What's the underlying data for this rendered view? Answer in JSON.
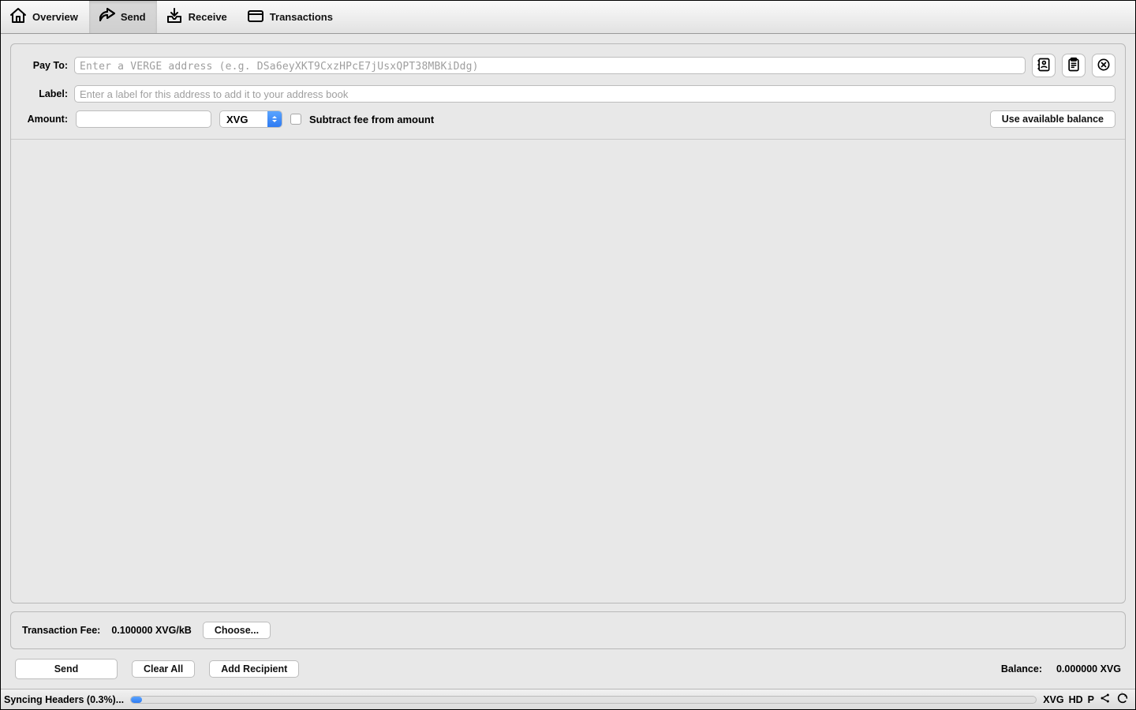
{
  "toolbar": {
    "overview": "Overview",
    "send": "Send",
    "receive": "Receive",
    "transactions": "Transactions"
  },
  "form": {
    "pay_to_label": "Pay To:",
    "pay_to_placeholder": "Enter a VERGE address (e.g. DSa6eyXKT9CxzHPcE7jUsxQPT38MBKiDdg)",
    "label_label": "Label:",
    "label_placeholder": "Enter a label for this address to add it to your address book",
    "amount_label": "Amount:",
    "unit_selected": "XVG",
    "subtract_fee_label": "Subtract fee from amount",
    "use_balance_btn": "Use available balance"
  },
  "fee": {
    "label": "Transaction Fee:",
    "value": "0.100000 XVG/kB",
    "choose_btn": "Choose..."
  },
  "actions": {
    "send": "Send",
    "clear_all": "Clear All",
    "add_recipient": "Add Recipient",
    "balance_label": "Balance:",
    "balance_value": "0.000000 XVG"
  },
  "status": {
    "sync_text": "Syncing Headers (0.3%)...",
    "ticker": "XVG",
    "hd": "HD",
    "proxy": "P"
  }
}
